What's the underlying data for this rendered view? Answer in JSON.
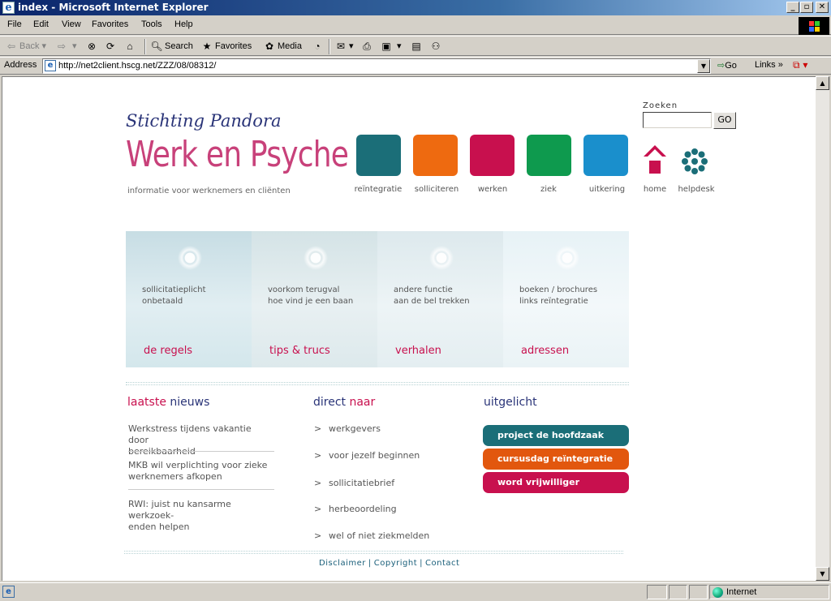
{
  "window": {
    "title": "index - Microsoft Internet Explorer"
  },
  "menu": [
    "File",
    "Edit",
    "View",
    "Favorites",
    "Tools",
    "Help"
  ],
  "toolbar": {
    "back": "Back",
    "search": "Search",
    "favorites": "Favorites",
    "media": "Media"
  },
  "address": {
    "label": "Address",
    "url": "http://net2client.hscg.net/ZZZ/08/08312/",
    "go": "Go",
    "links": "Links"
  },
  "page": {
    "org": "Stichting Pandora",
    "brand": "Werk en Psyche",
    "tagline": "informatie voor werknemers en cliënten",
    "search_label": "Zoeken",
    "search_button": "GO",
    "nav": [
      {
        "label": "reïntegratie",
        "color": "#1b6e78"
      },
      {
        "label": "solliciteren",
        "color": "#ee6a10"
      },
      {
        "label": "werken",
        "color": "#c8104e"
      },
      {
        "label": "ziek",
        "color": "#0e9a4e"
      },
      {
        "label": "uitkering",
        "color": "#1a8fcc"
      }
    ],
    "home_label": "home",
    "helpdesk_label": "helpdesk",
    "panels": [
      {
        "line1": "sollicitatieplicht",
        "line2": "onbetaald",
        "title": "de regels"
      },
      {
        "line1": "voorkom terugval",
        "line2": "hoe vind je een baan",
        "title": "tips & trucs"
      },
      {
        "line1": "andere functie",
        "line2": "aan de bel trekken",
        "title": "verhalen"
      },
      {
        "line1": "boeken / brochures",
        "line2": "links reïntegratie",
        "title": "adressen"
      }
    ],
    "news": {
      "title_a": "laatste",
      "title_b": " nieuws",
      "items": [
        {
          "l1": "Werkstress tijdens vakantie door",
          "l2": "bereikbaarheid"
        },
        {
          "l1": "MKB wil verplichting voor zieke",
          "l2": "werknemers afkopen"
        },
        {
          "l1": "RWI: juist nu kansarme werkzoek-",
          "l2": "enden helpen"
        }
      ]
    },
    "direct": {
      "title_a": "direct",
      "title_b": " naar",
      "bullet": ">",
      "items": [
        "werkgevers",
        "voor jezelf beginnen",
        "sollicitatiebrief",
        "herbeoordeling",
        "wel of niet ziekmelden"
      ]
    },
    "featured": {
      "title": "uitgelicht",
      "items": [
        {
          "label": "project de hoofdzaak",
          "color": "#1b6e78"
        },
        {
          "label": "cursusdag reïntegratie",
          "color": "#e2570e"
        },
        {
          "label": "word vrijwilliger",
          "color": "#c8104e"
        }
      ]
    },
    "footer": [
      "Disclaimer",
      "Copyright",
      "Contact"
    ]
  },
  "status": {
    "zone": "Internet"
  }
}
